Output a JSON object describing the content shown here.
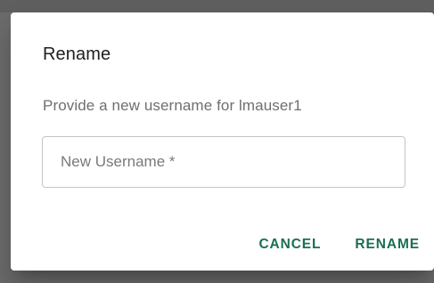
{
  "dialog": {
    "title": "Rename",
    "description": "Provide a new username for lmauser1",
    "input": {
      "placeholder": "New Username *",
      "value": ""
    },
    "actions": {
      "cancel_label": "CANCEL",
      "rename_label": "RENAME"
    }
  },
  "colors": {
    "accent": "#1b6e55",
    "backdrop": "#6b6b6b"
  }
}
